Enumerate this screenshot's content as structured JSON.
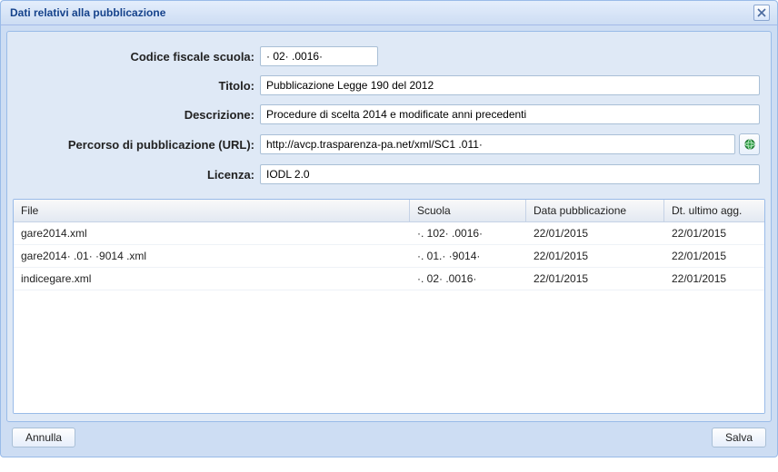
{
  "window": {
    "title": "Dati relativi alla pubblicazione"
  },
  "form": {
    "codice_fiscale_label": "Codice fiscale scuola:",
    "codice_fiscale_value": "· 02· .0016·",
    "titolo_label": "Titolo:",
    "titolo_value": "Pubblicazione Legge 190 del 2012",
    "descrizione_label": "Descrizione:",
    "descrizione_value": "Procedure di scelta 2014 e modificate anni precedenti",
    "url_label": "Percorso di pubblicazione (URL):",
    "url_value": "http://avcp.trasparenza-pa.net/xml/SC1 .011·",
    "licenza_label": "Licenza:",
    "licenza_value": "IODL 2.0"
  },
  "grid": {
    "columns": {
      "file": "File",
      "scuola": "Scuola",
      "data_pubblicazione": "Data pubblicazione",
      "dt_ultimo_agg": "Dt. ultimo agg."
    },
    "rows": [
      {
        "file": "gare2014.xml",
        "scuola": "·. 102· .0016·",
        "data": "22/01/2015",
        "agg": "22/01/2015"
      },
      {
        "file": "gare2014· .01· ·9014 .xml",
        "scuola": "·. 01.· ·9014·",
        "data": "22/01/2015",
        "agg": "22/01/2015"
      },
      {
        "file": "indicegare.xml",
        "scuola": "·. 02· .0016·",
        "data": "22/01/2015",
        "agg": "22/01/2015"
      }
    ]
  },
  "buttons": {
    "cancel": "Annulla",
    "save": "Salva"
  }
}
